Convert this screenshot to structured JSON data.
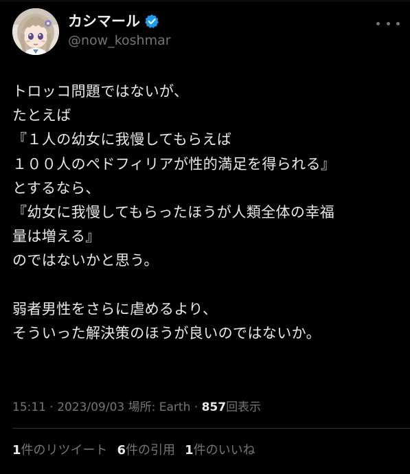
{
  "author": {
    "display_name": "カシマール",
    "handle": "@now_koshmar",
    "verified": true,
    "avatar_icon": "anime-girl-avatar"
  },
  "tweet": {
    "lines": [
      "トロッコ問題ではないが、",
      "たとえば",
      "『１人の幼女に我慢してもらえば",
      "１００人のペドフィリアが性的満足を得られる』",
      "とするなら、",
      "『幼女に我慢してもらったほうが人類全体の幸福",
      "量は増える』",
      "のではないかと思う。",
      "",
      "弱者男性をさらに虐めるより、",
      "そういった解決策のほうが良いのではないか。"
    ]
  },
  "meta": {
    "time": "15:11",
    "separator": "·",
    "date": "2023/09/03",
    "location_label": "場所:",
    "location": "Earth",
    "views_count": "857",
    "views_label": "回表示"
  },
  "stats": {
    "retweets_count": "1",
    "retweets_label": "件のリツイート",
    "quotes_count": "6",
    "quotes_label": "件の引用",
    "likes_count": "1",
    "likes_label": "件のいいね"
  },
  "colors": {
    "background": "#000000",
    "text": "#e7e9ea",
    "secondary_text": "#71767b",
    "verified": "#1d9bf0",
    "divider": "#2f3336"
  }
}
